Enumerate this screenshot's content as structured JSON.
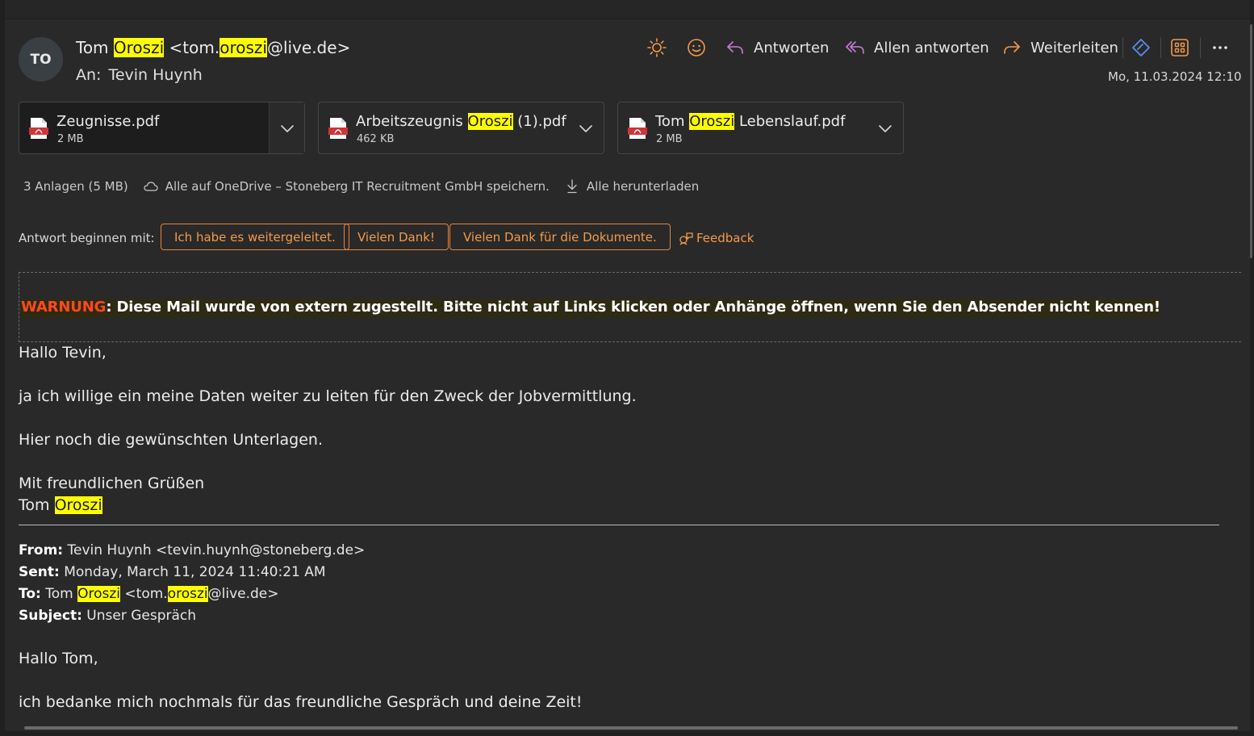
{
  "header": {
    "avatar_initials": "TO",
    "sender_first": "Tom",
    "sender_last": "Oroszi",
    "sender_email_prefix": "tom.",
    "sender_email_highlight": "oroszi",
    "sender_email_suffix": "@live.de",
    "to_label": "An:",
    "to_name": "Tevin Huynh",
    "date": "Mo, 11.03.2024 12:10"
  },
  "toolbar": {
    "reply_label": "Antworten",
    "reply_all_label": "Allen antworten",
    "forward_label": "Weiterleiten"
  },
  "attachments": [
    {
      "name_pre": "Zeugnisse.pdf",
      "name_hl": "",
      "name_post": "",
      "size": "2 MB"
    },
    {
      "name_pre": "Arbeitszeugnis",
      "name_hl": "Oroszi",
      "name_post": " (1).pdf",
      "size": "462 KB"
    },
    {
      "name_pre": "Tom",
      "name_hl": "Oroszi",
      "name_post": " Lebenslauf.pdf",
      "size": "2 MB"
    }
  ],
  "attachment_bar": {
    "count": "3 Anlagen (5 MB)",
    "onedrive": "Alle auf OneDrive – Stoneberg IT Recruitment GmbH speichern.",
    "download_all": "Alle herunterladen"
  },
  "quick_reply": {
    "label": "Antwort beginnen mit:",
    "chips": [
      "Ich habe es weitergeleitet.",
      "Vielen Dank!",
      "Vielen Dank für die Dokumente."
    ],
    "feedback": "Feedback"
  },
  "warning": {
    "keyword": "WARNUNG",
    "text": ": Diese Mail wurde von extern zugestellt. Bitte nicht auf Links klicken oder Anhänge öffnen, wenn Sie den Absender nicht kennen!"
  },
  "body": {
    "greeting": "Hallo Tevin,",
    "line1": "ja ich willige ein meine Daten weiter zu leiten für den Zweck der Jobvermittlung.",
    "line2": "Hier noch die gewünschten Unterlagen.",
    "closing": "Mit freundlichen Grüßen",
    "sig_first": "Tom",
    "sig_last": "Oroszi"
  },
  "quoted": {
    "from_label": "From:",
    "from_value": "Tevin Huynh <tevin.huynh@stoneberg.de>",
    "sent_label": "Sent:",
    "sent_value": "Monday, March 11, 2024 11:40:21 AM",
    "to_label": "To:",
    "to_first": "Tom",
    "to_last": "Oroszi",
    "to_email_prefix": "<tom.",
    "to_email_highlight": "oroszi",
    "to_email_suffix": "@live.de>",
    "subject_label": "Subject:",
    "subject_value": "Unser Gespräch",
    "greeting": "Hallo Tom,",
    "line1": "ich bedanke mich nochmals für das freundliche Gespräch und deine Zeit!"
  },
  "colors": {
    "accent_orange": "#f39a4a",
    "highlight": "#ffff00",
    "warning_red": "#ff4a1c",
    "background": "#292929"
  },
  "icons": [
    "sun-icon",
    "emoji-icon",
    "reply-icon",
    "reply-all-icon",
    "forward-icon",
    "viva-icon",
    "apps-icon",
    "more-icon",
    "pdf-icon",
    "chevron-down-icon",
    "cloud-icon",
    "download-icon",
    "feedback-icon"
  ]
}
